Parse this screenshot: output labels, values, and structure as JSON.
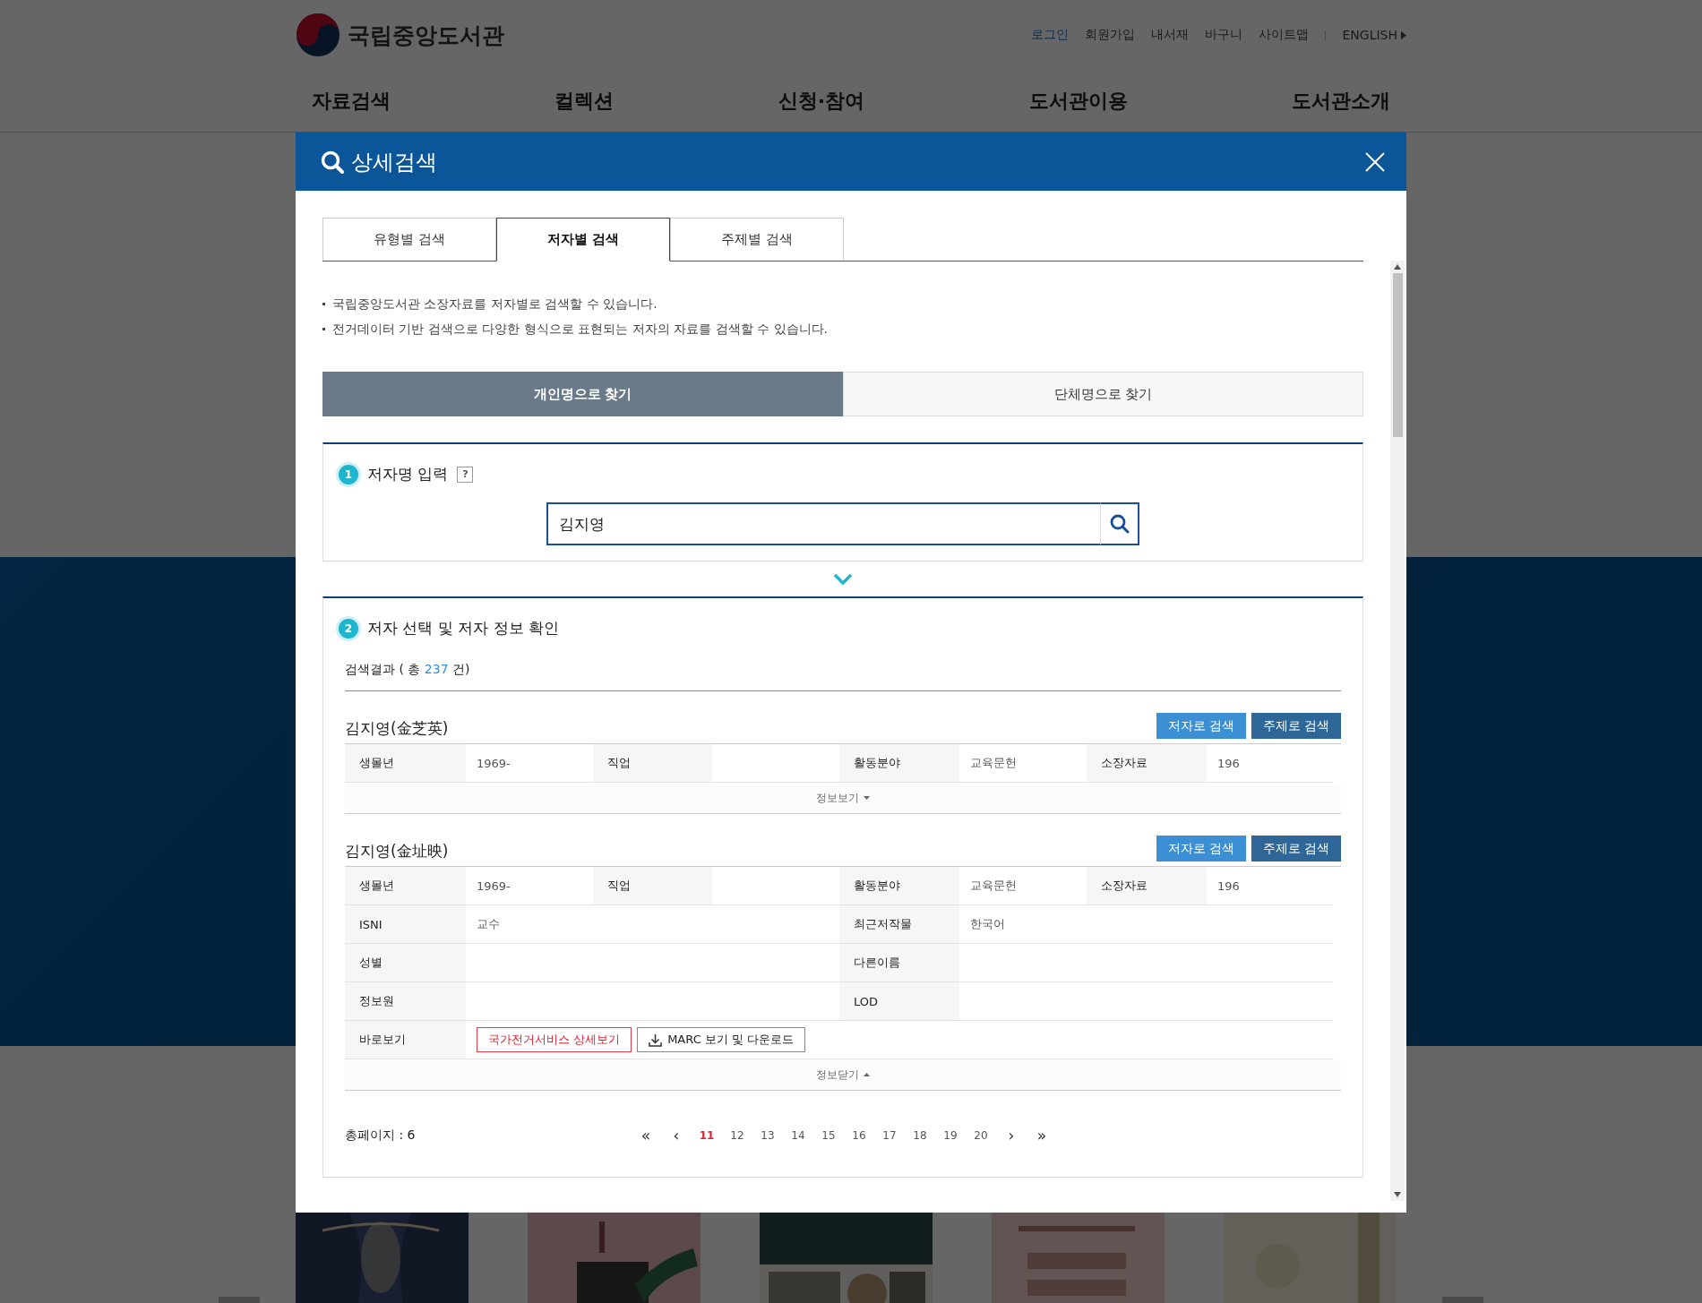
{
  "header": {
    "logo_text": "국립중앙도서관",
    "top_links": [
      {
        "label": "로그인",
        "highlighted": true
      },
      {
        "label": "회원가입",
        "highlighted": false
      },
      {
        "label": "내서재",
        "highlighted": false
      },
      {
        "label": "바구니",
        "highlighted": false
      },
      {
        "label": "사이트맵",
        "highlighted": false
      }
    ],
    "language": "ENGLISH",
    "nav": [
      "자료검색",
      "컬렉션",
      "신청·참여",
      "도서관이용",
      "도서관소개"
    ]
  },
  "modal": {
    "title": "상세검색",
    "tabs": [
      {
        "label": "유형별 검색",
        "selected": false
      },
      {
        "label": "저자별 검색",
        "selected": true
      },
      {
        "label": "주제별 검색",
        "selected": false
      }
    ],
    "notes": [
      "국립중앙도서관 소장자료를 저자별로 검색할 수 있습니다.",
      "전거데이터 기반 검색으로 다양한 형식으로 표현되는 저자의 자료를 검색할 수 있습니다."
    ],
    "mode_toggle": [
      {
        "label": "개인명으로 찾기",
        "selected": true
      },
      {
        "label": "단체명으로 찾기",
        "selected": false
      }
    ],
    "step1": {
      "number": "1",
      "title": "저자명 입력",
      "help": "?",
      "search": {
        "value": "김지영"
      }
    },
    "step2": {
      "number": "2",
      "title": "저자 선택 및 저자 정보 확인",
      "result_count": {
        "prefix": "검색결과 ( 총 ",
        "count": "237",
        "suffix": " 건)"
      },
      "authors": [
        {
          "name": "김지영(金芝英)",
          "buttons": [
            {
              "label": "저자로 검색",
              "kind": "author"
            },
            {
              "label": "주제로 검색",
              "kind": "subject"
            }
          ],
          "expanded": false,
          "fields": [
            {
              "label": "생몰년",
              "value": "1969-"
            },
            {
              "label": "직업"
            },
            {
              "label": "활동분야",
              "value": "교육문헌"
            },
            {
              "label": "소장자료",
              "value": "196"
            }
          ],
          "toggle_label": "정보보기"
        },
        {
          "name": "김지영(金址映)",
          "buttons": [
            {
              "label": "저자로 검색",
              "kind": "author"
            },
            {
              "label": "주제로 검색",
              "kind": "subject"
            }
          ],
          "expanded": true,
          "fields": [
            {
              "label": "생몰년",
              "value": "1969-"
            },
            {
              "label": "직업"
            },
            {
              "label": "활동분야",
              "value": "교육문헌"
            },
            {
              "label": "소장자료",
              "value": "196"
            }
          ],
          "details": [
            [
              {
                "label": "ISNI",
                "value": "교수"
              },
              {
                "label": "최근저작물",
                "value": "한국어"
              }
            ],
            [
              {
                "label": "성별"
              },
              {
                "label": "다른이름"
              }
            ],
            [
              {
                "label": "정보원"
              },
              {
                "label": "LOD"
              }
            ]
          ],
          "quick_view": {
            "label": "바로보기",
            "links": [
              {
                "label": "국가전거서비스 상세보기",
                "kind": "detail"
              },
              {
                "label": "MARC 보기 및 다운로드",
                "kind": "download"
              }
            ]
          },
          "toggle_label": "정보닫기"
        }
      ]
    },
    "pagination": {
      "total": "총페이지 : 6",
      "first": "«",
      "prev": "‹",
      "next": "›",
      "last": "»",
      "pages": [
        {
          "label": "11",
          "selected": true
        },
        {
          "label": "12",
          "selected": false
        },
        {
          "label": "13",
          "selected": false
        },
        {
          "label": "14",
          "selected": false
        },
        {
          "label": "15",
          "selected": false
        },
        {
          "label": "16",
          "selected": false
        },
        {
          "label": "17",
          "selected": false
        },
        {
          "label": "18",
          "selected": false
        },
        {
          "label": "19",
          "selected": false
        },
        {
          "label": "20",
          "selected": false
        }
      ]
    }
  }
}
